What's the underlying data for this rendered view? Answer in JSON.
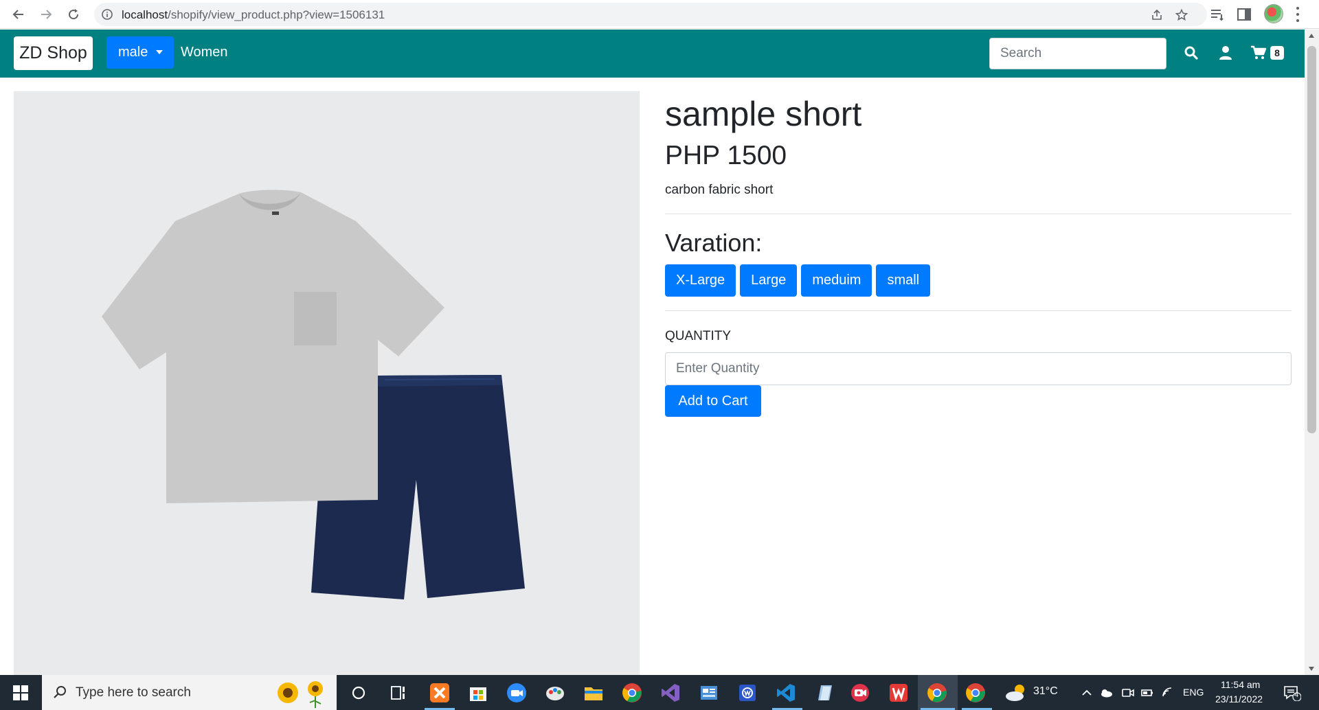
{
  "browser": {
    "url_host": "localhost",
    "url_path": "/shopify/view_product.php?view=1506131"
  },
  "navbar": {
    "brand": "ZD Shop",
    "menu_male": "male",
    "menu_women": "Women",
    "search_placeholder": "Search",
    "cart_count": "8",
    "background": "#008080",
    "accent": "#007bff"
  },
  "product": {
    "title": "sample short",
    "price": "PHP 1500",
    "description": "carbon fabric short",
    "variation_heading": "Varation:",
    "variations": [
      "X-Large",
      "Large",
      "meduim",
      "small"
    ],
    "quantity_label": "QUANTITY",
    "quantity_placeholder": "Enter Quantity",
    "add_to_cart": "Add to Cart"
  },
  "taskbar": {
    "search_text": "Type here to search",
    "weather": "31°C",
    "language": "ENG",
    "time": "11:54 am",
    "date": "23/11/2022",
    "notification_count": "4"
  }
}
